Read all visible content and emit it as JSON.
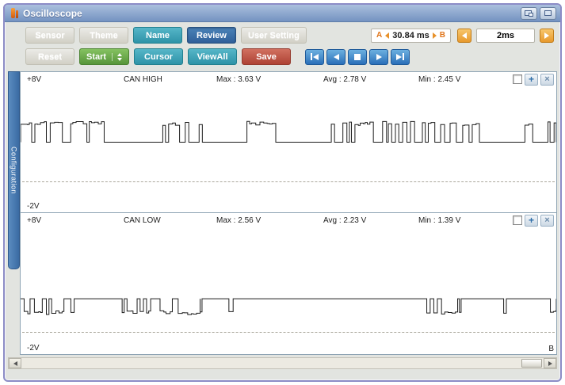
{
  "window": {
    "title": "Oscilloscope"
  },
  "toolbar": {
    "sensor": "Sensor",
    "theme": "Theme",
    "name": "Name",
    "review": "Review",
    "user_setting": "User Setting",
    "reset": "Reset",
    "start": "Start",
    "cursor": "Cursor",
    "viewall": "ViewAll",
    "save": "Save",
    "time_range": {
      "a": "A",
      "value": "30.84 ms",
      "b": "B"
    },
    "timebase": "2ms"
  },
  "sidebar": {
    "label": "Configuration"
  },
  "channels": [
    {
      "top_v": "+8V",
      "name": "CAN HIGH",
      "max": "Max : 3.63 V",
      "avg": "Avg : 2.78 V",
      "min": "Min : 2.45 V",
      "bottom_v": "-2V",
      "waveform": {
        "seed": 11,
        "baseline": 70,
        "amplitude": 26,
        "direction": "up"
      }
    },
    {
      "top_v": "+8V",
      "name": "CAN LOW",
      "max": "Max : 2.56 V",
      "avg": "Avg : 2.23 V",
      "min": "Min : 1.39 V",
      "bottom_v": "-2V",
      "cursor_label": "B",
      "waveform": {
        "seed": 29,
        "baseline": 89,
        "amplitude": 20,
        "direction": "down"
      }
    }
  ],
  "icons": {
    "add": "+",
    "close": "×",
    "playback": [
      "skip-to-start",
      "step-back",
      "stop",
      "play",
      "skip-to-end"
    ]
  }
}
